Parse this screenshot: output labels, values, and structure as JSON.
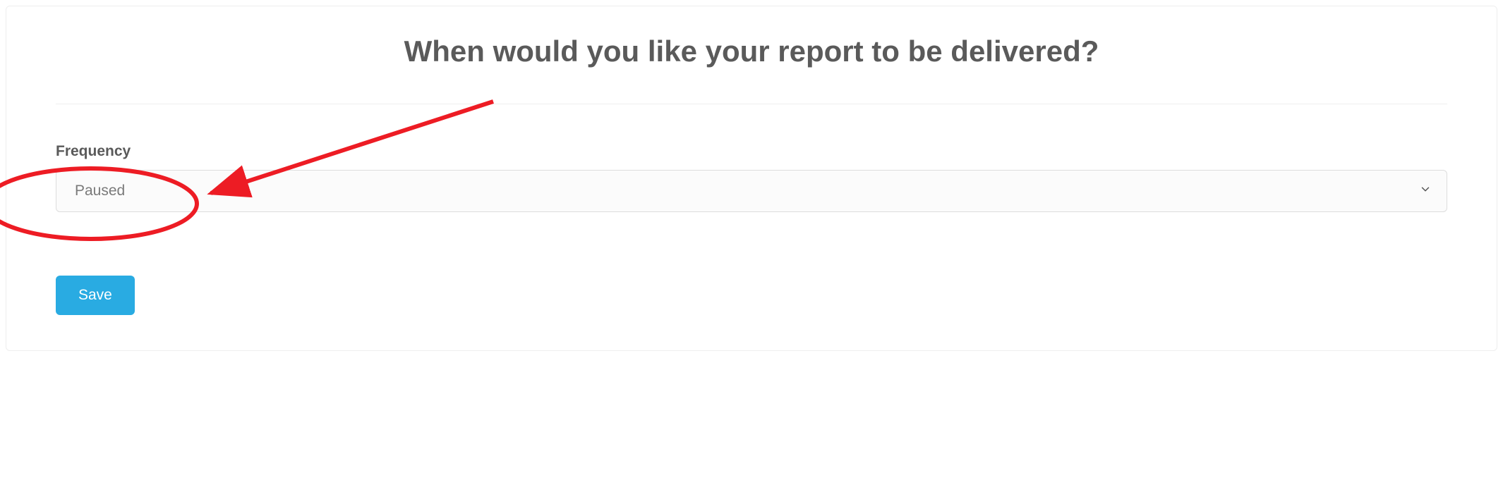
{
  "title": "When would you like your report to be delivered?",
  "form": {
    "frequency": {
      "label": "Frequency",
      "selected": "Paused"
    },
    "save_label": "Save"
  }
}
